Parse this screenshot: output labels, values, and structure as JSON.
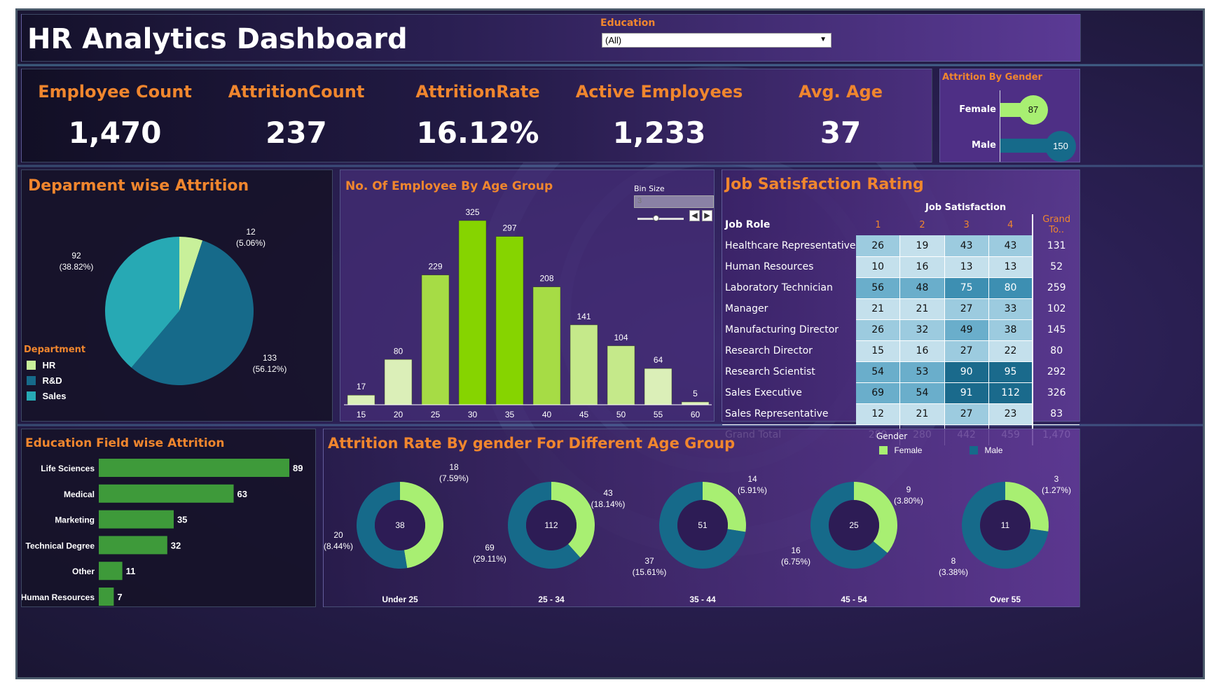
{
  "header": {
    "title": "HR Analytics Dashboard",
    "filter_label": "Education",
    "filter_value": "(All)"
  },
  "kpis": [
    {
      "label": "Employee Count",
      "value": "1,470"
    },
    {
      "label": "AttritionCount",
      "value": "237"
    },
    {
      "label": "AttritionRate",
      "value": "16.12%"
    },
    {
      "label": "Active Employees",
      "value": "1,233"
    },
    {
      "label": "Avg. Age",
      "value": "37"
    }
  ],
  "gender_attrition": {
    "title": "Attrition By Gender",
    "female_label": "Female",
    "female_value": "87",
    "male_label": "Male",
    "male_value": "150"
  },
  "department": {
    "title": "Deparment wise Attrition",
    "legend_title": "Department",
    "legend": [
      "HR",
      "R&D",
      "Sales"
    ],
    "slice_labels": [
      {
        "count": "12",
        "pct": "(5.06%)"
      },
      {
        "count": "133",
        "pct": "(56.12%)"
      },
      {
        "count": "92",
        "pct": "(38.82%)"
      }
    ]
  },
  "age_group": {
    "title": "No. Of Employee By Age Group",
    "bin_label": "Bin Size",
    "bin_value": "3"
  },
  "job_satisfaction": {
    "title": "Job Satisfaction Rating",
    "col_group": "Job Satisfaction",
    "row_header": "Job Role",
    "col_headers": [
      "1",
      "2",
      "3",
      "4",
      "Grand To.."
    ],
    "rows": [
      {
        "role": "Healthcare Representative",
        "vals": [
          "26",
          "19",
          "43",
          "43"
        ],
        "total": "131"
      },
      {
        "role": "Human Resources",
        "vals": [
          "10",
          "16",
          "13",
          "13"
        ],
        "total": "52"
      },
      {
        "role": "Laboratory Technician",
        "vals": [
          "56",
          "48",
          "75",
          "80"
        ],
        "total": "259"
      },
      {
        "role": "Manager",
        "vals": [
          "21",
          "21",
          "27",
          "33"
        ],
        "total": "102"
      },
      {
        "role": "Manufacturing Director",
        "vals": [
          "26",
          "32",
          "49",
          "38"
        ],
        "total": "145"
      },
      {
        "role": "Research Director",
        "vals": [
          "15",
          "16",
          "27",
          "22"
        ],
        "total": "80"
      },
      {
        "role": "Research Scientist",
        "vals": [
          "54",
          "53",
          "90",
          "95"
        ],
        "total": "292"
      },
      {
        "role": "Sales Executive",
        "vals": [
          "69",
          "54",
          "91",
          "112"
        ],
        "total": "326"
      },
      {
        "role": "Sales Representative",
        "vals": [
          "12",
          "21",
          "27",
          "23"
        ],
        "total": "83"
      }
    ],
    "grand_total": {
      "role": "Grand Total",
      "vals": [
        "289",
        "280",
        "442",
        "459"
      ],
      "total": "1,470"
    }
  },
  "education_field": {
    "title": "Education Field wise Attrition"
  },
  "gender_age": {
    "title": "Attrition Rate By gender For Different Age Group",
    "legend_title": "Gender",
    "legend": [
      "Female",
      "Male"
    ]
  },
  "colors": {
    "orange": "#f0862e",
    "hr": "#c8f09a",
    "rd": "#166a8a",
    "sales": "#27a9b4",
    "female": "#a8ef72",
    "male": "#166a8a",
    "edu_bar": "#3e9a3a"
  },
  "chart_data": [
    {
      "id": "department",
      "type": "pie",
      "title": "Deparment wise Attrition",
      "categories": [
        "HR",
        "R&D",
        "Sales"
      ],
      "values": [
        12,
        133,
        92
      ],
      "percents": [
        5.06,
        56.12,
        38.82
      ]
    },
    {
      "id": "age_group",
      "type": "bar",
      "title": "No. Of Employee By Age Group",
      "categories": [
        "15",
        "20",
        "25",
        "30",
        "35",
        "40",
        "45",
        "50",
        "55",
        "60"
      ],
      "values": [
        17,
        80,
        229,
        325,
        297,
        208,
        141,
        104,
        64,
        5
      ]
    },
    {
      "id": "education_field",
      "type": "bar",
      "orientation": "horizontal",
      "title": "Education Field wise Attrition",
      "categories": [
        "Life Sciences",
        "Medical",
        "Marketing",
        "Technical Degree",
        "Other",
        "Human Resources"
      ],
      "values": [
        89,
        63,
        35,
        32,
        11,
        7
      ]
    },
    {
      "id": "gender_attrition",
      "type": "bar",
      "orientation": "horizontal",
      "title": "Attrition By Gender",
      "categories": [
        "Female",
        "Male"
      ],
      "values": [
        87,
        150
      ]
    },
    {
      "id": "gender_age",
      "type": "pie",
      "subtype": "donut",
      "title": "Attrition Rate By gender For Different Age Group",
      "groups": [
        {
          "label": "Under 25",
          "total": "38",
          "female": 18,
          "female_pct": "(7.59%)",
          "male": 20,
          "male_pct": "(8.44%)"
        },
        {
          "label": "25 - 34",
          "total": "112",
          "female": 43,
          "female_pct": "(18.14%)",
          "male": 69,
          "male_pct": "(29.11%)"
        },
        {
          "label": "35 - 44",
          "total": "51",
          "female": 14,
          "female_pct": "(5.91%)",
          "male": 37,
          "male_pct": "(15.61%)"
        },
        {
          "label": "45 - 54",
          "total": "25",
          "female": 9,
          "female_pct": "(3.80%)",
          "male": 16,
          "male_pct": "(6.75%)"
        },
        {
          "label": "Over 55",
          "total": "11",
          "female": 3,
          "female_pct": "(1.27%)",
          "male": 8,
          "male_pct": "(3.38%)"
        }
      ]
    }
  ]
}
